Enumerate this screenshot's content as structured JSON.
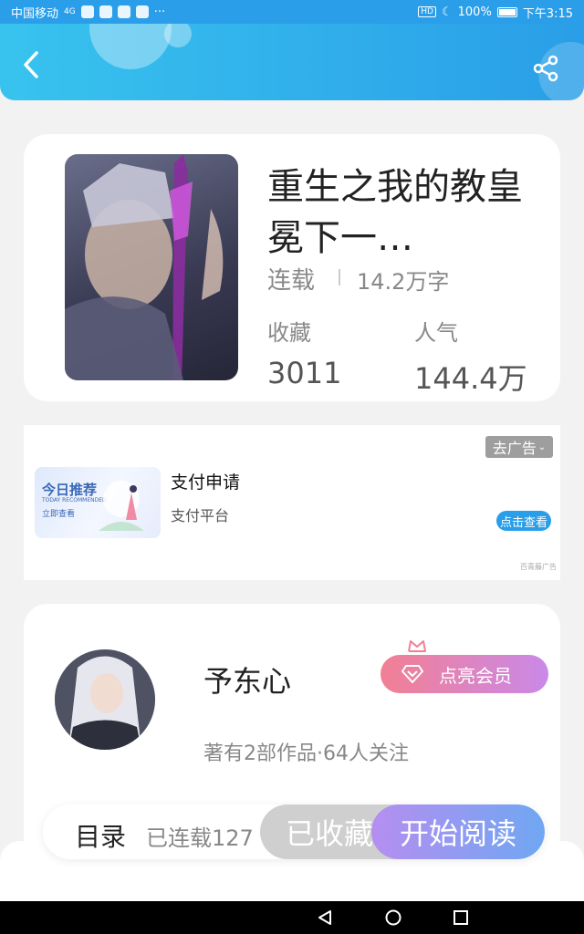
{
  "status_bar": {
    "carrier": "中国移动",
    "network": "4G",
    "battery": "100%",
    "time": "下午3:15",
    "more": "···"
  },
  "header": {
    "back_icon": "back-icon",
    "share_icon": "share-icon",
    "accent_color": "#2a9ee8"
  },
  "book": {
    "title": "重生之我的教皇冕下一…",
    "status": "连载",
    "word_count": "14.2万字",
    "favorites_label": "收藏",
    "favorites_value": "3011",
    "popularity_label": "人气",
    "popularity_value": "144.4万"
  },
  "ad": {
    "remove_label": "去广告",
    "image_title": "今日推荐",
    "image_subtitle": "TODAY RECOMMENDED",
    "image_button": "立即查看",
    "title": "支付申请",
    "description": "支付平台",
    "button": "点击查看",
    "source": "百青藤广告"
  },
  "author": {
    "name": "予东心",
    "vip_button": "点亮会员",
    "stats": "著有2部作品·64人关注"
  },
  "bottom_bar": {
    "toc_label": "目录",
    "toc_count": "已连载127",
    "collected_button": "已收藏",
    "read_button": "开始阅读"
  }
}
